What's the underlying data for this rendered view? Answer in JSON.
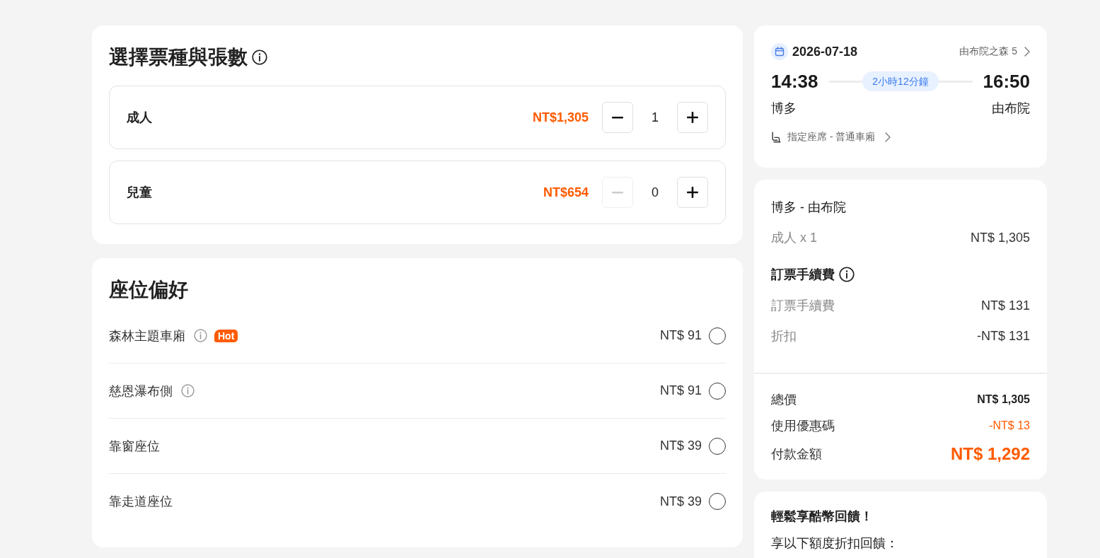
{
  "ticket_section": {
    "title": "選擇票種與張數",
    "tickets": [
      {
        "label": "成人",
        "price": "NT$1,305",
        "count": "1",
        "minus_disabled": false
      },
      {
        "label": "兒童",
        "price": "NT$654",
        "count": "0",
        "minus_disabled": true
      }
    ]
  },
  "seat_section": {
    "title": "座位偏好",
    "options": [
      {
        "label": "森林主題車廂",
        "info": true,
        "badge": "Hot",
        "price": "NT$ 91",
        "selected": false
      },
      {
        "label": "慈恩瀑布側",
        "info": true,
        "price": "NT$ 91",
        "selected": false
      },
      {
        "label": "靠窗座位",
        "info": false,
        "price": "NT$ 39",
        "selected": false
      },
      {
        "label": "靠走道座位",
        "info": false,
        "price": "NT$ 39",
        "selected": false
      }
    ]
  },
  "trip_card": {
    "date": "2026-07-18",
    "train": "由布院之森 5",
    "depart_time": "14:38",
    "duration": "2小時12分鐘",
    "arrive_time": "16:50",
    "from": "博多",
    "to": "由布院",
    "seat_class": "指定座席 - 普通車廂"
  },
  "price_summary": {
    "route": "博多 - 由布院",
    "items": [
      {
        "label": "成人 x 1",
        "amount": "NT$ 1,305"
      }
    ],
    "fee_title": "訂票手續費",
    "fees": [
      {
        "label": "訂票手續費",
        "amount": "NT$ 131"
      },
      {
        "label": "折扣",
        "amount": "-NT$ 131"
      }
    ],
    "totals": [
      {
        "kind": "subtotal",
        "label": "總價",
        "amount": "NT$ 1,305"
      },
      {
        "kind": "discount",
        "label": "使用優惠碼",
        "amount": "-NT$ 13"
      },
      {
        "kind": "payment",
        "label": "付款金額",
        "amount": "NT$ 1,292"
      }
    ]
  },
  "rewards_card": {
    "title": "輕鬆享酷幣回饋！",
    "text": "享以下額度折扣回饋："
  }
}
